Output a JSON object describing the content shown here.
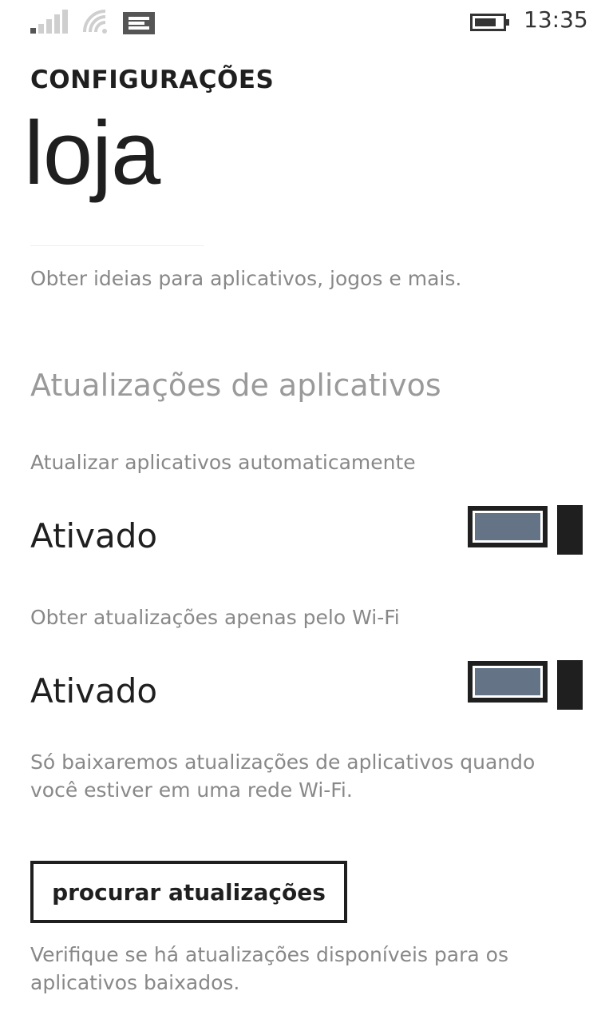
{
  "status_bar": {
    "time": "13:35",
    "icons": [
      "signal-icon",
      "wifi-icon",
      "notification-icon",
      "battery-icon"
    ]
  },
  "header": {
    "section": "CONFIGURAÇÕES",
    "title": "loja"
  },
  "tips_link": "Obter ideias para aplicativos, jogos e mais.",
  "app_updates": {
    "title": "Atualizações de aplicativos",
    "auto_update": {
      "label": "Atualizar aplicativos automaticamente",
      "value": "Ativado",
      "on": true
    },
    "wifi_only": {
      "label": "Obter atualizações apenas pelo Wi-Fi",
      "value": "Ativado",
      "on": true
    },
    "wifi_note": "Só baixaremos atualizações de aplicativos quando você estiver em uma rede Wi-Fi."
  },
  "check_updates": {
    "button_label": "procurar atualizações",
    "description": "Verifique se há atualizações disponíveis para os aplicativos baixados."
  },
  "colors": {
    "toggle_fill": "#647486",
    "text_dark": "#1f1f1f",
    "text_muted": "#888888"
  }
}
